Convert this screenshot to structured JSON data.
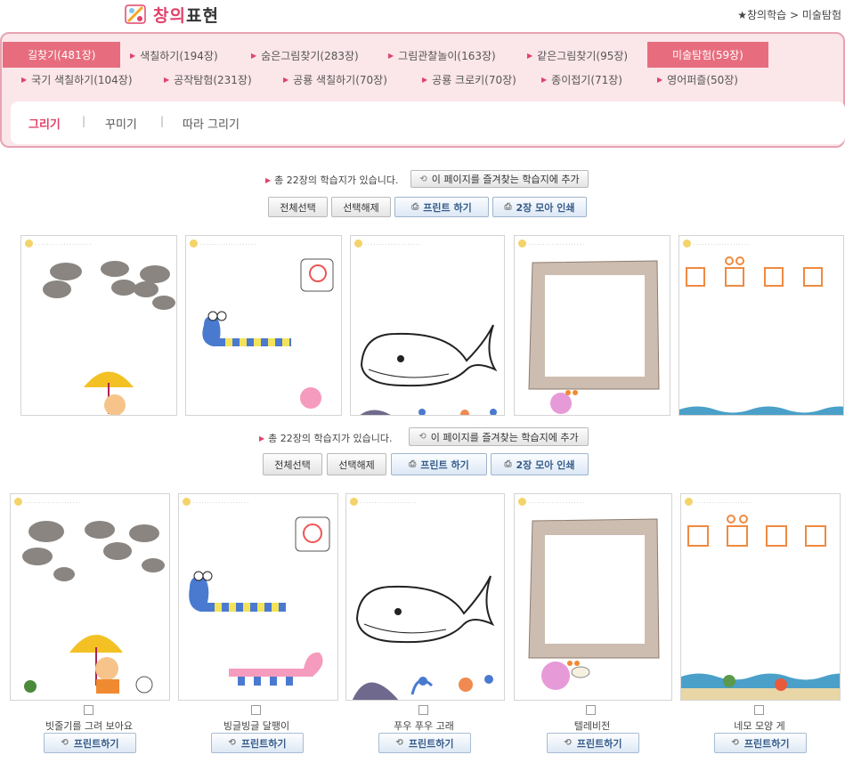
{
  "header": {
    "logo_text_a": "창의",
    "logo_text_b": "표현",
    "breadcrumb": "★창의학습 > 미술탐험"
  },
  "menu": {
    "row1": [
      "길찾기(481장)",
      "색칠하기(194장)",
      "숨은그림찾기(283장)",
      "그림관찰놀이(163장)",
      "같은그림찾기(95장)",
      "미술탐험(59장)"
    ],
    "row2": [
      "국기 색칠하기(104장)",
      "공작탐험(231장)",
      "공룡 색칠하기(70장)",
      "공룡 크로키(70장)",
      "종이접기(71장)",
      "영어퍼즐(50장)"
    ],
    "active_row1": 0,
    "active_row1_b": 5
  },
  "subtabs": [
    "그리기",
    "꾸미기",
    "따라 그리기"
  ],
  "summary": {
    "text": "총 22장의 학습지가 있습니다.",
    "bookmark": "이 페이지를 즐겨찾는 학습지에 추가"
  },
  "actions": {
    "select_all": "전체선택",
    "deselect": "선택해제",
    "print": "프린트 하기",
    "print2": "2장 모아 인쇄"
  },
  "worksheets": [
    {
      "title": "빗줄기를 그려 보아요",
      "print": "프린트하기",
      "icon": "cloud-rain-icon"
    },
    {
      "title": "빙글빙글 달팽이",
      "print": "프린트하기",
      "icon": "snail-worm-icon"
    },
    {
      "title": "푸우 푸우 고래",
      "print": "프린트하기",
      "icon": "whale-icon"
    },
    {
      "title": "텔레비전",
      "print": "프린트하기",
      "icon": "television-frame-icon"
    },
    {
      "title": "네모 모양 게",
      "print": "프린트하기",
      "icon": "crab-squares-icon"
    }
  ],
  "colors": {
    "accent": "#e0436a",
    "menu_bg": "#fbe6ea",
    "active_tab": "#e76d7e",
    "button_blue": "#355b8a"
  }
}
